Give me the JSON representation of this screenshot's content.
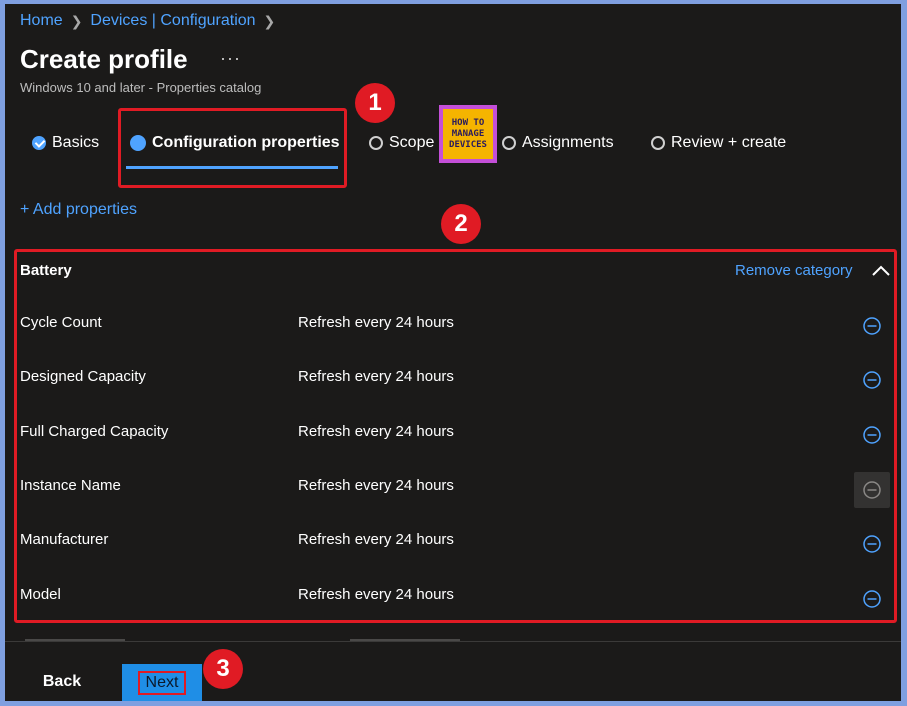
{
  "breadcrumb": {
    "items": [
      "Home",
      "Devices | Configuration"
    ]
  },
  "header": {
    "title": "Create profile",
    "more": "···",
    "subtitle": "Windows 10 and later - Properties catalog"
  },
  "steps": [
    {
      "label": "Basics",
      "state": "completed"
    },
    {
      "label": "Configuration properties",
      "state": "active"
    },
    {
      "label": "Scope",
      "state": "pending"
    },
    {
      "label": "Assignments",
      "state": "pending"
    },
    {
      "label": "Review + create",
      "state": "pending"
    }
  ],
  "logo": {
    "line1": "HOW TO",
    "line2": "MANAGE",
    "line3": "DEVICES"
  },
  "annotations": {
    "one": "1",
    "two": "2",
    "three": "3"
  },
  "add_properties": "+ Add properties",
  "category": {
    "title": "Battery",
    "remove_label": "Remove category",
    "rows": [
      {
        "name": "Cycle Count",
        "value": "Refresh every 24 hours"
      },
      {
        "name": "Designed Capacity",
        "value": "Refresh every 24 hours"
      },
      {
        "name": "Full Charged Capacity",
        "value": "Refresh every 24 hours"
      },
      {
        "name": "Instance Name",
        "value": "Refresh every 24 hours"
      },
      {
        "name": "Manufacturer",
        "value": "Refresh every 24 hours"
      },
      {
        "name": "Model",
        "value": "Refresh every 24 hours"
      }
    ]
  },
  "footer": {
    "back_label": "Back",
    "next_label": "Next"
  },
  "colors": {
    "accent": "#4fa3ff",
    "annotation_red": "#e01b24",
    "background": "#1b1a19",
    "primary_button": "#1f8ee6"
  }
}
